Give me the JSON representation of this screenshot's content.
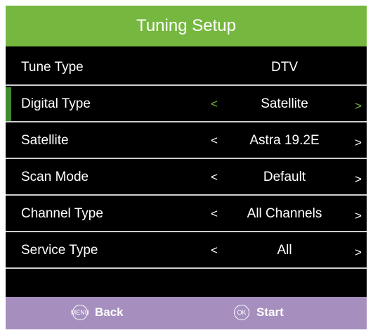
{
  "title": "Tuning Setup",
  "menu": {
    "rows": [
      {
        "label": "Tune Type",
        "value": "DTV",
        "left_arrow": "",
        "right_arrow": ""
      },
      {
        "label": "Digital Type",
        "value": "Satellite",
        "left_arrow": "<",
        "right_arrow": ">"
      },
      {
        "label": "Satellite",
        "value": "Astra 19.2E",
        "left_arrow": "<",
        "right_arrow": ">"
      },
      {
        "label": "Scan Mode",
        "value": "Default",
        "left_arrow": "<",
        "right_arrow": ">"
      },
      {
        "label": "Channel Type",
        "value": "All Channels",
        "left_arrow": "<",
        "right_arrow": ">"
      },
      {
        "label": "Service Type",
        "value": "All",
        "left_arrow": "<",
        "right_arrow": ">"
      }
    ],
    "selected_row": "Digital Type"
  },
  "footer": {
    "back": {
      "icon": "menu-button-icon",
      "icon_text": "MENU",
      "label": "Back"
    },
    "start": {
      "icon": "ok-button-icon",
      "icon_text": "OK",
      "label": "Start"
    }
  },
  "colors": {
    "title_bar": "#76b83f",
    "selected_marker": "#3f8a2f",
    "footer": "#a68fbe",
    "background": "#000000"
  }
}
